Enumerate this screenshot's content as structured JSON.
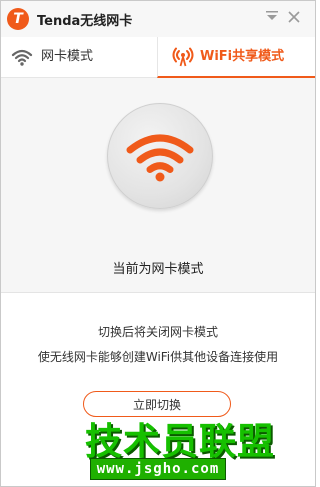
{
  "window": {
    "title": "Tenda无线网卡",
    "logo_letter": "T"
  },
  "tabs": [
    {
      "label": "网卡模式",
      "icon": "wifi-icon",
      "active": false
    },
    {
      "label": "WiFi共享模式",
      "icon": "wifi-share-icon",
      "active": true
    }
  ],
  "status": {
    "text": "当前为网卡模式",
    "icon": "wifi-icon"
  },
  "info": {
    "line1": "切换后将关闭网卡模式",
    "line2": "使无线网卡能够创建WiFi供其他设备连接使用"
  },
  "action": {
    "switch_label": "立即切换"
  },
  "watermark": {
    "title": "技术员联盟",
    "url": "www.jsgho.com"
  },
  "colors": {
    "accent": "#f05a1a",
    "watermark_green": "#16c000"
  }
}
